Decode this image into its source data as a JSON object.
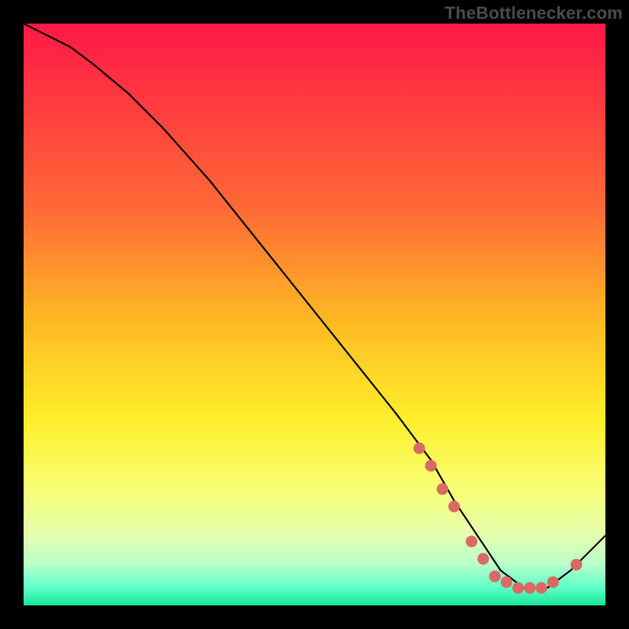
{
  "watermark": "TheBottlenecker.com",
  "chart_data": {
    "type": "line",
    "title": "",
    "xlabel": "",
    "ylabel": "",
    "xlim": [
      0,
      100
    ],
    "ylim": [
      0,
      100
    ],
    "background_gradient_stops": [
      {
        "offset": 0,
        "color": "#ff1846"
      },
      {
        "offset": 32,
        "color": "#ff6a36"
      },
      {
        "offset": 52,
        "color": "#ffbd23"
      },
      {
        "offset": 68,
        "color": "#ffee2a"
      },
      {
        "offset": 80,
        "color": "#f8ff75"
      },
      {
        "offset": 88,
        "color": "#e4ffb0"
      },
      {
        "offset": 93,
        "color": "#b8ffca"
      },
      {
        "offset": 97,
        "color": "#5fffc8"
      },
      {
        "offset": 100,
        "color": "#15e698"
      }
    ],
    "series": [
      {
        "name": "curve",
        "stroke": "#000000",
        "x": [
          0,
          4,
          8,
          12,
          18,
          24,
          32,
          40,
          48,
          56,
          64,
          70,
          74,
          78,
          82,
          86,
          90,
          94,
          100
        ],
        "y": [
          100,
          98,
          96,
          93,
          88,
          82,
          73,
          63,
          53,
          43,
          33,
          25,
          18,
          12,
          6,
          3,
          3,
          6,
          12
        ]
      }
    ],
    "markers": {
      "color": "#d96a63",
      "radius_pct": 1.0,
      "points": [
        {
          "x": 68,
          "y": 27
        },
        {
          "x": 70,
          "y": 24
        },
        {
          "x": 72,
          "y": 20
        },
        {
          "x": 74,
          "y": 17
        },
        {
          "x": 77,
          "y": 11
        },
        {
          "x": 79,
          "y": 8
        },
        {
          "x": 81,
          "y": 5
        },
        {
          "x": 83,
          "y": 4
        },
        {
          "x": 85,
          "y": 3
        },
        {
          "x": 87,
          "y": 3
        },
        {
          "x": 89,
          "y": 3
        },
        {
          "x": 91,
          "y": 4
        },
        {
          "x": 95,
          "y": 7
        }
      ]
    }
  }
}
